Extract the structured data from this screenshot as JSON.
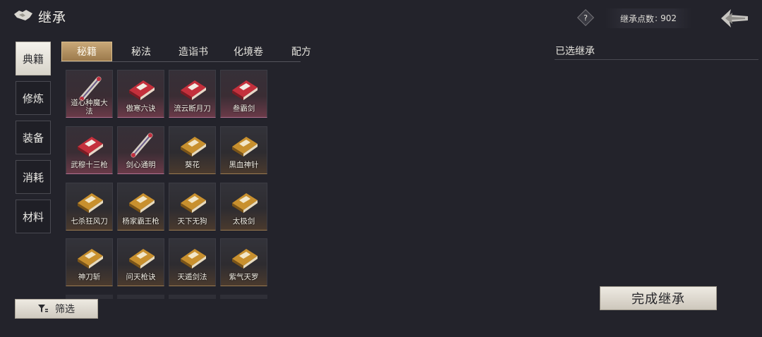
{
  "header": {
    "title": "继承",
    "points_label": "继承点数",
    "points_separator": ":",
    "points_value": "902"
  },
  "categories": [
    {
      "label": "典籍",
      "active": true
    },
    {
      "label": "修炼",
      "active": false
    },
    {
      "label": "装备",
      "active": false
    },
    {
      "label": "消耗",
      "active": false
    },
    {
      "label": "材料",
      "active": false
    }
  ],
  "tabs": [
    {
      "label": "秘籍",
      "active": true
    },
    {
      "label": "秘法",
      "active": false
    },
    {
      "label": "造诣书",
      "active": false
    },
    {
      "label": "化境卷",
      "active": false
    },
    {
      "label": "配方",
      "active": false
    }
  ],
  "items": [
    {
      "name": "道心种魔大法",
      "icon": "scroll-icon"
    },
    {
      "name": "傲寒六诀",
      "icon": "red-book-icon"
    },
    {
      "name": "流云断月刀",
      "icon": "red-book-icon"
    },
    {
      "name": "叁霸剑",
      "icon": "red-book-icon"
    },
    {
      "name": "武穆十三枪",
      "icon": "red-book-icon"
    },
    {
      "name": "剑心通明",
      "icon": "scroll-icon"
    },
    {
      "name": "葵花",
      "icon": "gold-book-icon"
    },
    {
      "name": "黑血神针",
      "icon": "gold-book-icon"
    },
    {
      "name": "七杀狂风刀",
      "icon": "gold-book-icon"
    },
    {
      "name": "杨家霸王枪",
      "icon": "gold-book-icon"
    },
    {
      "name": "天下无狗",
      "icon": "gold-book-icon"
    },
    {
      "name": "太极剑",
      "icon": "gold-book-icon"
    },
    {
      "name": "神刀斩",
      "icon": "gold-book-icon"
    },
    {
      "name": "问天枪诀",
      "icon": "gold-book-icon"
    },
    {
      "name": "天遁剑法",
      "icon": "gold-book-icon"
    },
    {
      "name": "紫气天罗",
      "icon": "gold-book-icon"
    }
  ],
  "filter": {
    "label": "筛选"
  },
  "selected_panel": {
    "title": "已选继承"
  },
  "complete_button": {
    "label": "完成继承"
  },
  "help": {
    "label": "?"
  },
  "colors": {
    "accent_gold": "#c9a878",
    "background": "#23232b",
    "button_light": "#eeeae2"
  }
}
